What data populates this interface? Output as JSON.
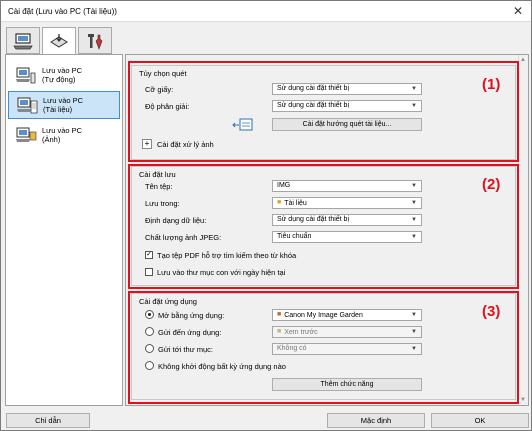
{
  "window": {
    "title": "Cài đặt (Lưu vào PC (Tài liệu))"
  },
  "sidebar": {
    "items": [
      {
        "line1": "Lưu vào PC",
        "line2": "(Tự động)"
      },
      {
        "line1": "Lưu vào PC",
        "line2": "(Tài liệu)"
      },
      {
        "line1": "Lưu vào PC",
        "line2": "(Ảnh)"
      }
    ]
  },
  "section1": {
    "title": "Tùy chọn quét",
    "number": "(1)",
    "paper_size_label": "Cỡ giấy:",
    "paper_size_value": "Sử dụng cài đặt thiết bị",
    "resolution_label": "Độ phân giải:",
    "resolution_value": "Sử dụng cài đặt thiết bị",
    "orientation_button": "Cài đặt hướng quét tài liệu...",
    "image_processing": "Cài đặt xử lý ảnh"
  },
  "section2": {
    "title": "Cài đặt lưu",
    "number": "(2)",
    "filename_label": "Tên tệp:",
    "filename_value": "IMG",
    "save_in_label": "Lưu trong:",
    "save_in_value": "Tài liệu",
    "format_label": "Định dạng dữ liệu:",
    "format_value": "Sử dụng cài đặt thiết bị",
    "jpeg_label": "Chất lượng ảnh JPEG:",
    "jpeg_value": "Tiêu chuẩn",
    "pdf_keyword": "Tạo tệp PDF hỗ trợ tìm kiếm theo từ khóa",
    "subfolder": "Lưu vào thư mục con với ngày hiện tại"
  },
  "section3": {
    "title": "Cài đặt ứng dụng",
    "number": "(3)",
    "open_with_label": "Mở bằng ứng dụng:",
    "open_with_value": "Canon My Image Garden",
    "send_app_label": "Gửi đến ứng dụng:",
    "send_app_value": "Xem trước",
    "send_folder_label": "Gửi tới thư mục:",
    "send_folder_value": "Không có",
    "no_app": "Không khởi động bất kỳ ứng dụng nào",
    "more_functions": "Thêm chức năng"
  },
  "footer": {
    "guide": "Chỉ dẫn",
    "defaults": "Mặc định",
    "ok": "OK"
  },
  "colors": {
    "highlight_red": "#e0101c",
    "selection": "#cce4f7"
  }
}
